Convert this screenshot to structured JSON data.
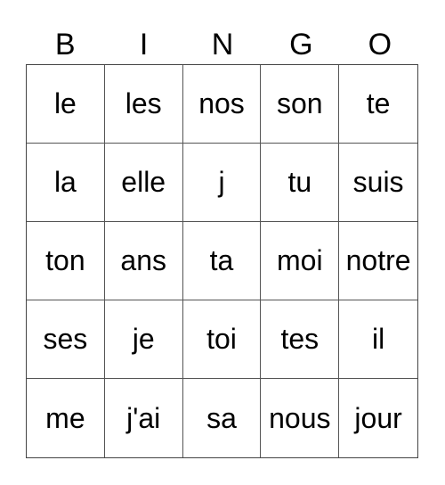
{
  "header": [
    "B",
    "I",
    "N",
    "G",
    "O"
  ],
  "cells": [
    [
      "le",
      "les",
      "nos",
      "son",
      "te"
    ],
    [
      "la",
      "elle",
      "j",
      "tu",
      "suis"
    ],
    [
      "ton",
      "ans",
      "ta",
      "moi",
      "notre"
    ],
    [
      "ses",
      "je",
      "toi",
      "tes",
      "il"
    ],
    [
      "me",
      "j'ai",
      "sa",
      "nous",
      "jour"
    ]
  ]
}
